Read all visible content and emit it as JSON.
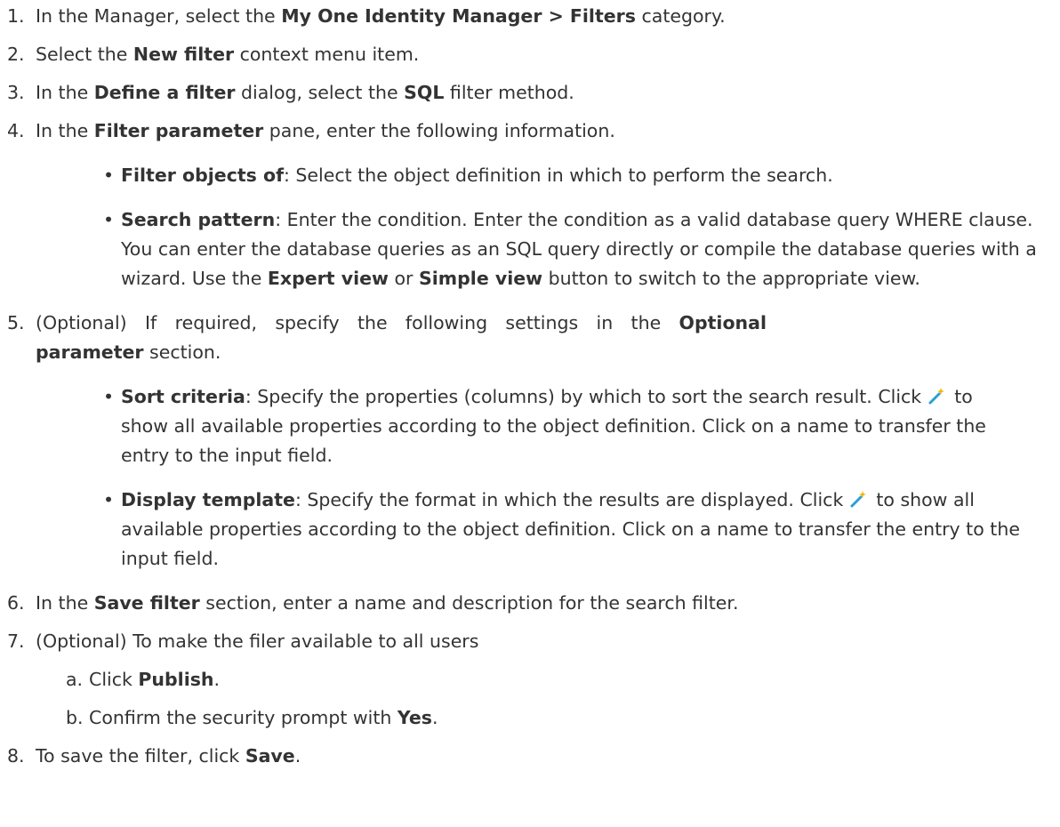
{
  "steps": {
    "s1": {
      "num": "1.",
      "pre": "In the Manager, select the ",
      "bold": "My One Identity Manager > Filters",
      "post": " category."
    },
    "s2": {
      "num": "2.",
      "pre": "Select the ",
      "bold": "New filter",
      "post": " context menu item."
    },
    "s3": {
      "num": "3.",
      "pre": "In the ",
      "bold1": "Define a filter",
      "mid": " dialog, select the ",
      "bold2": "SQL",
      "post": " filter method."
    },
    "s4": {
      "num": "4.",
      "pre": "In the ",
      "bold": "Filter parameter",
      "post": " pane, enter the following information.",
      "b1": {
        "bold": "Filter objects of",
        "text": ": Select the object definition in which to perform the search."
      },
      "b2": {
        "bold": "Search pattern",
        "text": ": Enter the condition. Enter the condition as a valid database query WHERE clause. You can enter the database queries as an SQL query directly or compile the database queries with a wizard. Use the ",
        "bold2": "Expert view",
        "mid": " or ",
        "bold3": "Simple view",
        "post": " button to switch to the appropriate view."
      }
    },
    "s5": {
      "num": "5.",
      "pre": "(Optional) If required, specify the following settings in the ",
      "bold": "Optional parameter",
      "post": " section.",
      "b1": {
        "bold": "Sort criteria",
        "text": ": Specify the properties (columns) by which to sort the search result. Click ",
        "post": " to show all available properties according to the object definition. Click on a name to transfer the entry to the input field."
      },
      "b2": {
        "bold": "Display template",
        "text": ": Specify the format in which the results are displayed. Click ",
        "post": " to show all available properties according to the object definition. Click on a name to transfer the entry to the input field."
      }
    },
    "s6": {
      "num": "6.",
      "pre": "In the ",
      "bold": "Save filter",
      "post": " section, enter a name and description for the search filter."
    },
    "s7": {
      "num": "7.",
      "text": "(Optional) To make the filer available to all users",
      "a": {
        "letter": "a.",
        "pre": "Click ",
        "bold": "Publish",
        "post": "."
      },
      "b": {
        "letter": "b.",
        "pre": "Confirm the security prompt with ",
        "bold": "Yes",
        "post": "."
      }
    },
    "s8": {
      "num": "8.",
      "pre": "To save the filter, click ",
      "bold": "Save",
      "post": "."
    }
  },
  "bullet_char": "•",
  "icons": {
    "wizard": "magic-wand-icon"
  },
  "colors": {
    "text": "#333333",
    "wand": "#2a9fd6",
    "spark": "#f0b400"
  }
}
